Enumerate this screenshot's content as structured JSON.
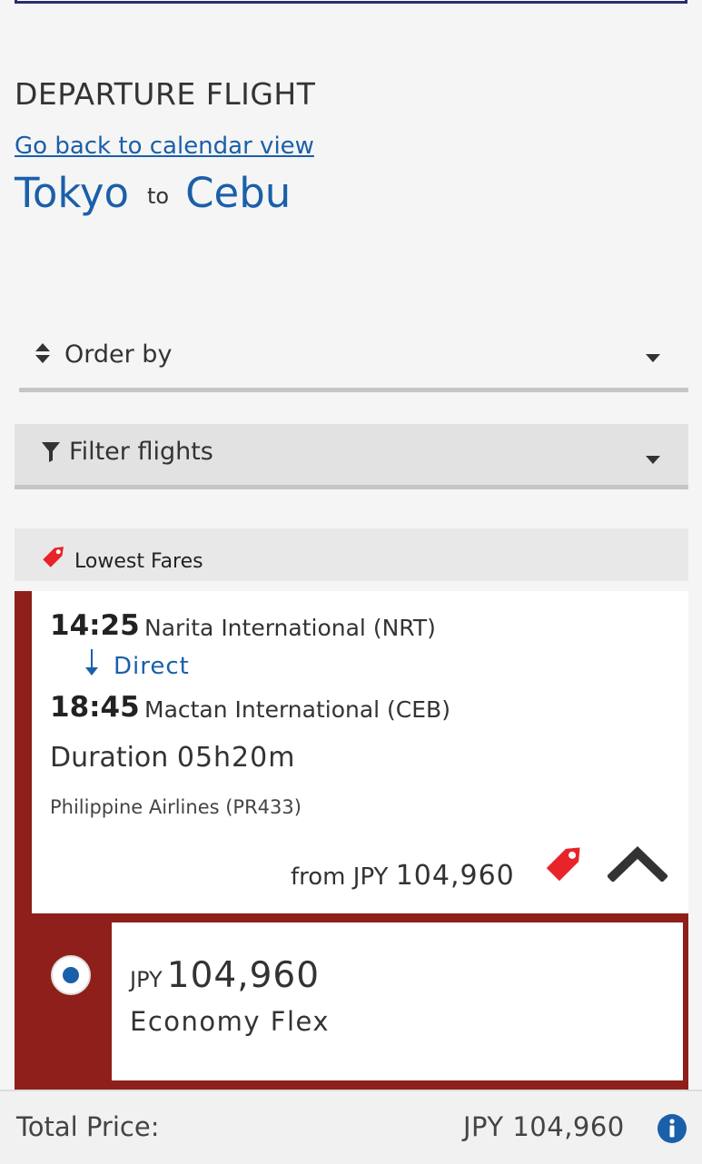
{
  "header": {
    "section_title": "DEPARTURE FLIGHT",
    "back_link": "Go back to calendar view",
    "origin": "Tokyo",
    "to_word": "to",
    "destination": "Cebu"
  },
  "controls": {
    "order_by_label": "Order by",
    "filter_label": "Filter flights"
  },
  "lowest_fares_label": "Lowest Fares",
  "flight": {
    "departure_time": "14:25",
    "departure_airport": "Narita International (NRT)",
    "stop_type": "Direct",
    "arrival_time": "18:45",
    "arrival_airport": "Mactan International (CEB)",
    "duration_label": "Duration",
    "duration_value": "05h20m",
    "airline": "Philippine Airlines (PR433)",
    "from_label": "from JPY",
    "from_amount": "104,960"
  },
  "fare": {
    "currency": "JPY",
    "amount": "104,960",
    "name": "Economy Flex",
    "selected": true
  },
  "total": {
    "label": "Total Price:",
    "value": "JPY 104,960"
  },
  "colors": {
    "accent_blue": "#1a5faa",
    "card_red": "#8e1f1a",
    "tag_red": "#e8232a",
    "top_border_navy": "#2b2d6e"
  }
}
